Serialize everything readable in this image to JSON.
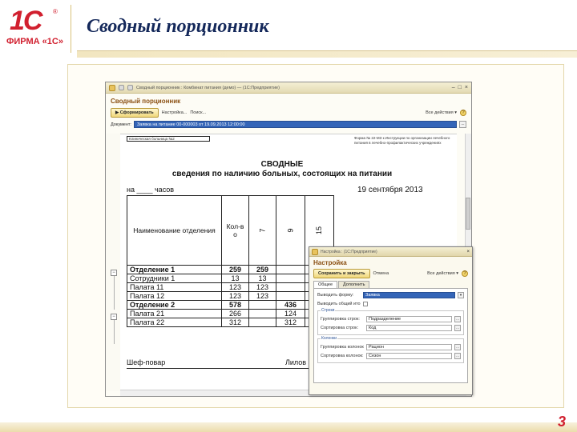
{
  "slide": {
    "logo_mark": "1С",
    "logo_reg": "®",
    "logo_text": "ФИРМА «1С»",
    "title": "Сводный порционник",
    "page_number": "3"
  },
  "window": {
    "title": "Сводный порционник : Комбинат питания (демо) — (1С:Предприятие)",
    "form_title": "Сводный порционник",
    "toolbar": {
      "generate": "Сформировать",
      "settings": "Настройка...",
      "find": "Поиск...",
      "all_actions": "Все действия ▾",
      "help": "?"
    },
    "document_label": "Документ:",
    "document_value": "Заявка на питание 00-000003 от 19.09.2013 12:00:00",
    "document_btn": "..."
  },
  "report": {
    "org_cell": "Клиническая больница №2",
    "form_note": "Форма № 22-МЗ к Инструкции по организации лечебного питания в лечебно-профилактических учреждениях",
    "title1": "СВОДНЫЕ",
    "title2": "сведения по наличию больных, состоящих на питании",
    "hours_line": "на ____ часов",
    "date": "19 сентября 2013",
    "headers": {
      "dept": "Наименование отделения",
      "count": "Кол-в о",
      "col7": "7",
      "col9": "9",
      "col15": "15"
    },
    "rows": [
      {
        "name": "Отделение 1",
        "count": "259",
        "c7": "259",
        "c9": "",
        "bold": true
      },
      {
        "name": "Сотрудники 1",
        "count": "13",
        "c7": "13",
        "c9": "",
        "bold": false
      },
      {
        "name": "Палата 11",
        "count": "123",
        "c7": "123",
        "c9": "",
        "bold": false
      },
      {
        "name": "Палата 12",
        "count": "123",
        "c7": "123",
        "c9": "",
        "bold": false
      },
      {
        "name": "Отделение 2",
        "count": "578",
        "c7": "",
        "c9": "436",
        "bold": true
      },
      {
        "name": "Палата 21",
        "count": "266",
        "c7": "",
        "c9": "124",
        "bold": false
      },
      {
        "name": "Палата 22",
        "count": "312",
        "c7": "",
        "c9": "312",
        "bold": false
      }
    ],
    "chef_label": "Шеф-повар",
    "chef_name": "Лилов"
  },
  "dialog": {
    "title": "Настройка : (1С:Предприятие)",
    "form_title": "Настройка",
    "save_close": "Сохранить и закрыть",
    "cancel": "Отмена",
    "all_actions": "Все действия ▾",
    "help": "?",
    "tabs": [
      "Общее",
      "Дополнить"
    ],
    "output_form_label": "Выводить форму:",
    "output_form_value": "Заявка",
    "totals_label": "Выводить общий итог:",
    "rows_group": "Строки",
    "rows_grouping_label": "Группировка строк:",
    "rows_grouping_value": "Подразделение",
    "rows_sort_label": "Сортировка строк:",
    "rows_sort_value": "Код",
    "cols_group": "Колонки",
    "cols_grouping_label": "Группировка колонок:",
    "cols_grouping_value": "Рацион",
    "cols_sort_label": "Сортировка колонок:",
    "cols_sort_value": "Сезон",
    "field_btn": "..."
  },
  "colors": {
    "brand_red": "#d1202f",
    "title_navy": "#14285a",
    "form_title_brown": "#8a4f12",
    "selection_blue": "#3465b8"
  }
}
